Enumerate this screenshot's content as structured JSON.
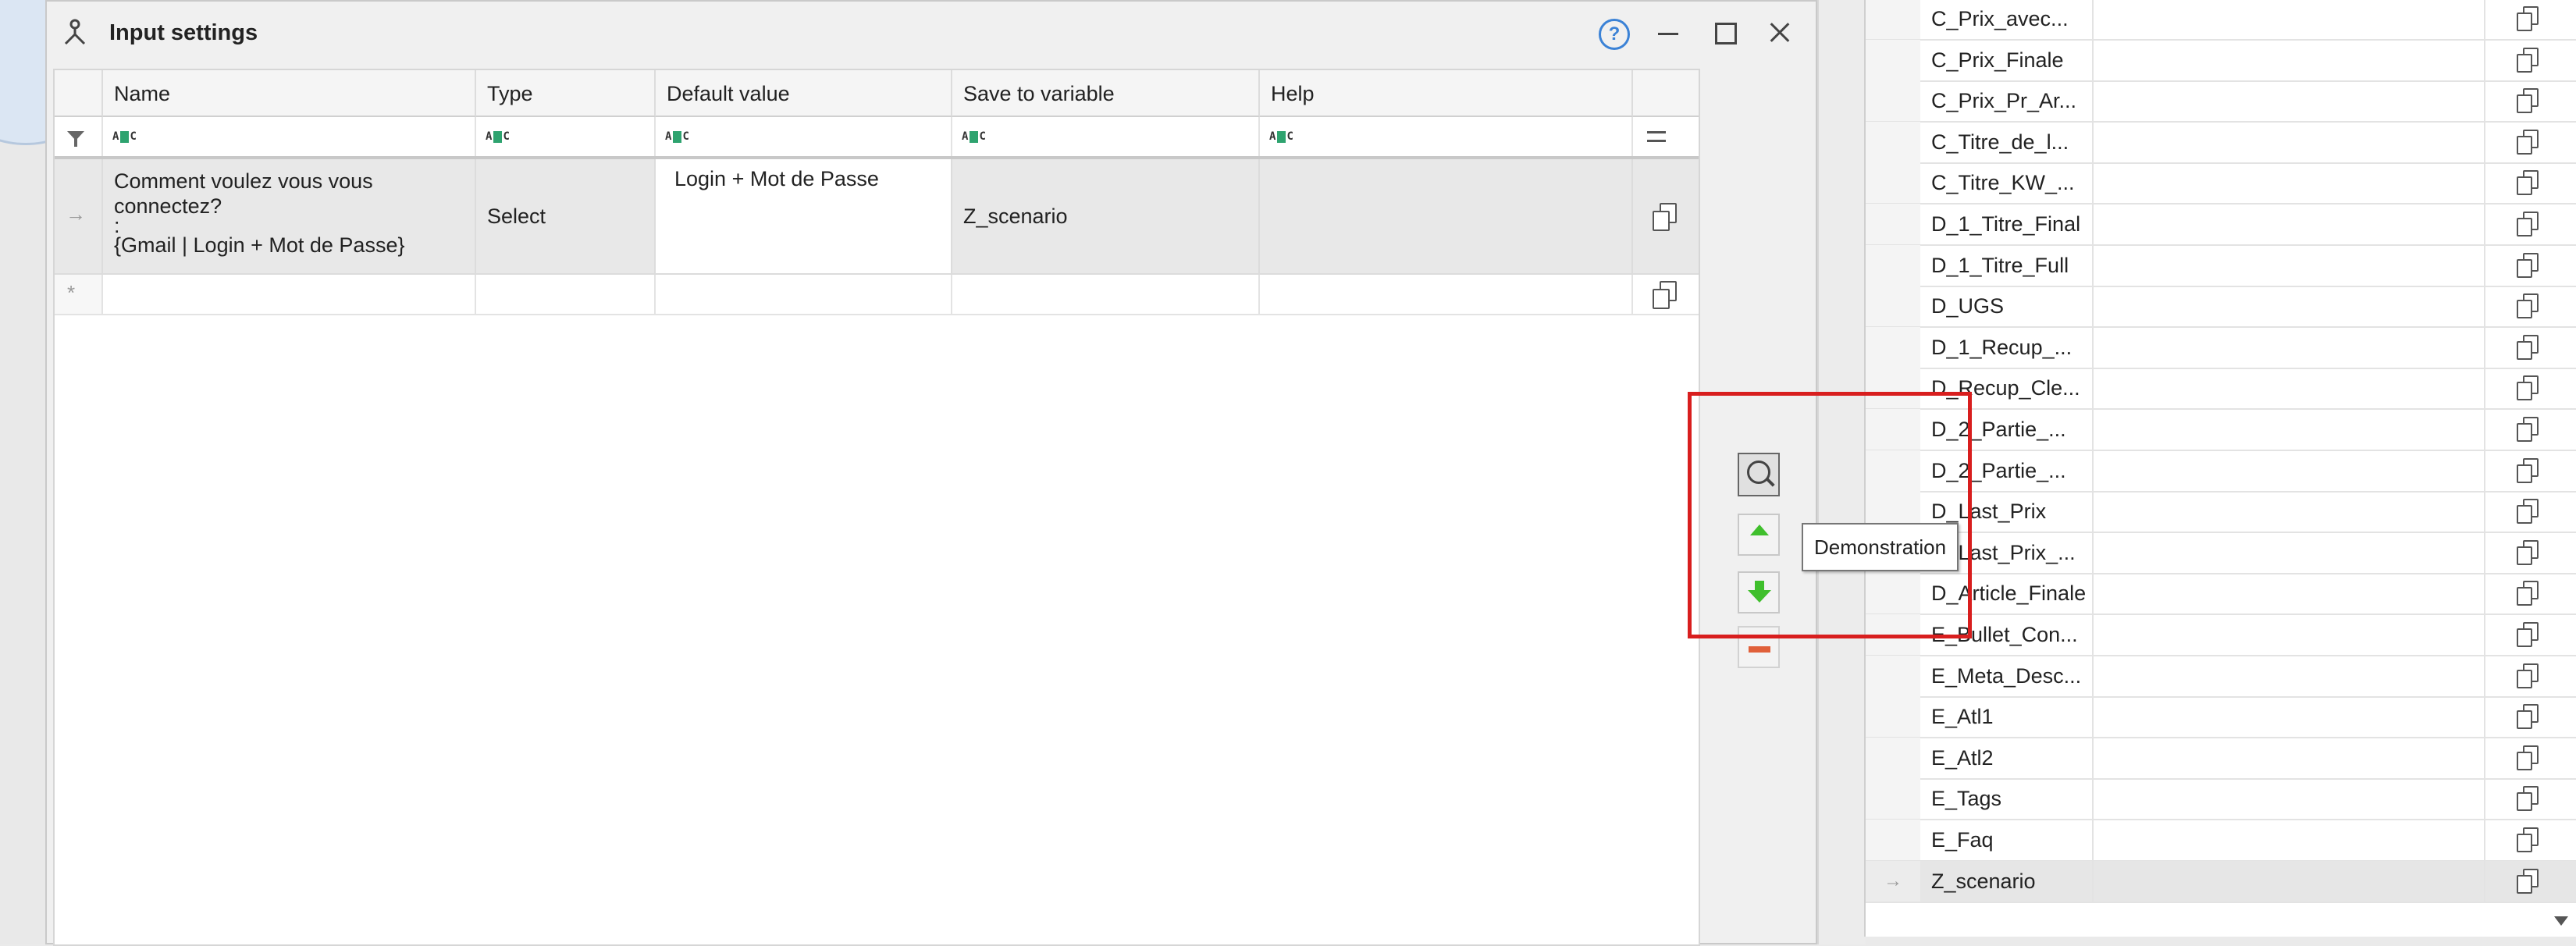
{
  "dialog": {
    "title": "Input settings",
    "help_label": "?"
  },
  "grid": {
    "columns": [
      "Name",
      "Type",
      "Default value",
      "Save to variable",
      "Help"
    ],
    "filter_glyph": "ABC",
    "rows": [
      {
        "name_line1": "Comment voulez vous vous connectez?",
        "name_line2": ":",
        "name_line3": "{Gmail | Login + Mot de Passe}",
        "type": "Select",
        "default_value": "Login + Mot de Passe",
        "save_to_variable": "Z_scenario",
        "help": ""
      }
    ],
    "row_indicator": "→",
    "new_row_indicator": "*"
  },
  "side_buttons": {
    "tooltip": "Demonstration"
  },
  "variables": {
    "items": [
      "C_Prix_avec...",
      "C_Prix_Finale",
      "C_Prix_Pr_Ar...",
      "C_Titre_de_l...",
      "C_Titre_KW_...",
      "D_1_Titre_Final",
      "D_1_Titre_Full",
      "D_UGS",
      "D_1_Recup_...",
      "D_Recup_Cle...",
      "D_2_Partie_...",
      "D_2_Partie_...",
      "D_Last_Prix",
      "D_Last_Prix_...",
      "D_Article_Finale",
      "E_Bullet_Con...",
      "E_Meta_Desc...",
      "E_Atl1",
      "E_Atl2",
      "E_Tags",
      "E_Faq",
      "Z_scenario"
    ],
    "selected_index": 21,
    "selected_indicator": "→"
  },
  "colors": {
    "highlight_box": "#d81e1e",
    "arrow_green": "#3fbf2c",
    "help_blue": "#3b82d6"
  }
}
